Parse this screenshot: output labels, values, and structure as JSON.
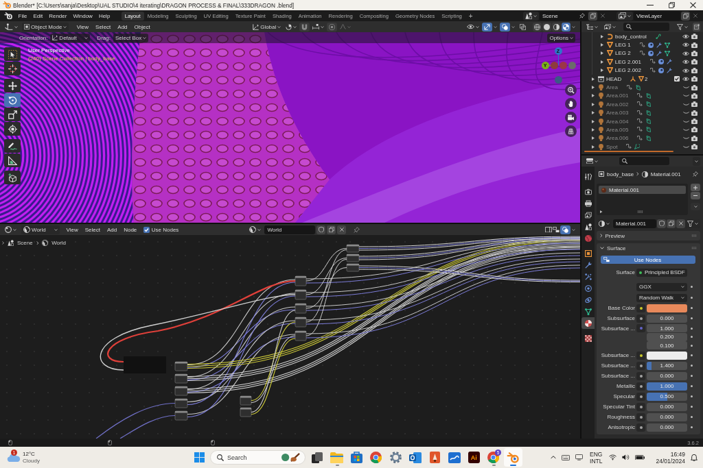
{
  "window": {
    "title": "Blender* [C:\\Users\\sanja\\Desktop\\UAL STUDIO\\4 iterating\\DRAGON PROCESS & FINAL\\333DRAGON .blend]"
  },
  "topbar": {
    "menus": [
      "File",
      "Edit",
      "Render",
      "Window",
      "Help"
    ],
    "workspaces": [
      {
        "label": "Layout",
        "selected": true
      },
      {
        "label": "Modeling",
        "selected": false
      },
      {
        "label": "Sculpting",
        "selected": false
      },
      {
        "label": "UV Editing",
        "selected": false
      },
      {
        "label": "Texture Paint",
        "selected": false
      },
      {
        "label": "Shading",
        "selected": false
      },
      {
        "label": "Animation",
        "selected": false
      },
      {
        "label": "Rendering",
        "selected": false
      },
      {
        "label": "Compositing",
        "selected": false
      },
      {
        "label": "Geometry Nodes",
        "selected": false
      },
      {
        "label": "Scripting",
        "selected": false
      }
    ],
    "add_workspace": "+",
    "scene": "Scene",
    "view_layer": "ViewLayer"
  },
  "viewport": {
    "mode": "Object Mode",
    "menus": [
      "View",
      "Select",
      "Add",
      "Object"
    ],
    "transform_orientation": "Global",
    "toggles": [
      {
        "kind": "snap",
        "on": false
      },
      {
        "kind": "proportional_editing",
        "on": false
      },
      {
        "kind": "gizmos",
        "on": true
      },
      {
        "kind": "overlays",
        "on": true
      },
      {
        "kind": "xray",
        "on": false
      }
    ],
    "shading_modes": [
      {
        "kind": "wireframe",
        "selected": false
      },
      {
        "kind": "solid",
        "selected": false
      },
      {
        "kind": "material_preview",
        "selected": false
      },
      {
        "kind": "rendered",
        "selected": true
      }
    ],
    "tool_settings": {
      "orientation_label": "Orientation:",
      "orientation": "Default",
      "drag_label": "Drag:",
      "drag": "Select Box",
      "options": "Options"
    },
    "view_name": "User Perspective",
    "view_info": "(240) Scene Collection | body_base",
    "tool_groups": [
      [
        {
          "kind": "select_box",
          "selected": false
        },
        {
          "kind": "cursor",
          "selected": false
        }
      ],
      [
        {
          "kind": "move",
          "selected": false
        },
        {
          "kind": "rotate",
          "selected": true
        },
        {
          "kind": "scale",
          "selected": false
        },
        {
          "kind": "transform",
          "selected": false
        }
      ],
      [
        {
          "kind": "annotate",
          "selected": false
        },
        {
          "kind": "measure",
          "selected": false
        }
      ],
      [
        {
          "kind": "add_cube",
          "selected": false
        }
      ]
    ],
    "gizmo_axes": [
      {
        "label": "Z",
        "color": "#2f74c9"
      },
      {
        "label": "Y",
        "color": "#7cb318"
      },
      {
        "color": "#8e3b3b"
      },
      {
        "color": "#9c3548"
      },
      {
        "color": "#6b6b6b"
      },
      {
        "color": "#3b5a86"
      }
    ]
  },
  "outliner": {
    "scrolled_parent": {
      "children": [
        {
          "name": "body_control",
          "kind": "armature",
          "extras": [
            {
              "kind": "bone_constraint"
            }
          ],
          "visible": true
        },
        {
          "name": "LEG 1",
          "kind": "mesh",
          "extras": [
            {
              "kind": "parent"
            },
            {
              "kind": "modifier"
            },
            {
              "kind": "wrench"
            },
            {
              "kind": "vertex_data"
            }
          ],
          "visible": true
        },
        {
          "name": "LEG 2",
          "kind": "mesh",
          "extras": [
            {
              "kind": "parent"
            },
            {
              "kind": "modifier"
            },
            {
              "kind": "wrench"
            },
            {
              "kind": "vertex_data"
            }
          ],
          "visible": true
        },
        {
          "name": "LEG 2.001",
          "kind": "mesh",
          "extras": [
            {
              "kind": "parent"
            },
            {
              "kind": "modifier"
            },
            {
              "kind": "wrench"
            }
          ],
          "visible": true
        },
        {
          "name": "LEG 2.002",
          "kind": "mesh",
          "extras": [
            {
              "kind": "parent"
            },
            {
              "kind": "modifier"
            },
            {
              "kind": "wrench"
            }
          ],
          "visible": true
        }
      ]
    },
    "items": [
      {
        "name": "HEAD",
        "kind": "collection",
        "extras": [
          {
            "kind": "armature"
          },
          {
            "kind": "mesh"
          }
        ],
        "count": "2",
        "checked": true,
        "visible": true
      },
      {
        "name": "Area",
        "kind": "light",
        "extras": [
          {
            "kind": "parent"
          },
          {
            "kind": "area_light"
          }
        ],
        "visible": false
      },
      {
        "name": "Area.001",
        "kind": "light",
        "extras": [
          {
            "kind": "parent"
          },
          {
            "kind": "area_light"
          }
        ],
        "visible": false
      },
      {
        "name": "Area.002",
        "kind": "light",
        "extras": [
          {
            "kind": "parent"
          },
          {
            "kind": "area_light"
          }
        ],
        "visible": false
      },
      {
        "name": "Area.003",
        "kind": "light",
        "extras": [
          {
            "kind": "parent"
          },
          {
            "kind": "area_light"
          }
        ],
        "visible": false
      },
      {
        "name": "Area.004",
        "kind": "light",
        "extras": [
          {
            "kind": "parent"
          },
          {
            "kind": "area_light"
          }
        ],
        "visible": false
      },
      {
        "name": "Area.005",
        "kind": "light",
        "extras": [
          {
            "kind": "parent"
          },
          {
            "kind": "area_light"
          }
        ],
        "visible": false
      },
      {
        "name": "Area.006",
        "kind": "light",
        "extras": [
          {
            "kind": "parent"
          },
          {
            "kind": "area_light"
          }
        ],
        "visible": false
      },
      {
        "name": "Spot",
        "kind": "light",
        "extras": [
          {
            "kind": "parent"
          },
          {
            "kind": "spot_light"
          }
        ],
        "visible": false
      }
    ]
  },
  "node_editor": {
    "shader_type": "World",
    "menus": [
      "View",
      "Select",
      "Add",
      "Node"
    ],
    "use_nodes": {
      "label": "Use Nodes",
      "checked": true
    },
    "datablock": "World",
    "overlays_on": true,
    "breadcrumbs": [
      "Scene",
      "World"
    ]
  },
  "properties": {
    "tab_groups": [
      [
        {
          "kind": "tool",
          "selected": false
        }
      ],
      [
        {
          "kind": "render",
          "selected": false
        },
        {
          "kind": "output",
          "selected": false
        },
        {
          "kind": "view_layer",
          "selected": false
        },
        {
          "kind": "scene",
          "selected": false
        },
        {
          "kind": "world",
          "selected": false
        }
      ],
      [
        {
          "kind": "object",
          "selected": false
        },
        {
          "kind": "modifiers",
          "selected": false
        },
        {
          "kind": "particles",
          "selected": false
        },
        {
          "kind": "physics",
          "selected": false
        },
        {
          "kind": "constraints",
          "selected": false
        },
        {
          "kind": "data",
          "selected": false
        },
        {
          "kind": "material",
          "selected": true
        }
      ],
      [
        {
          "kind": "texture",
          "selected": false
        }
      ]
    ],
    "object": "body_base",
    "material": "Material.001",
    "slots": [
      {
        "name": "Material.001",
        "selected": true
      }
    ],
    "datablock": "Material.001",
    "panels": [
      {
        "title": "Preview",
        "expanded": false
      },
      {
        "title": "Surface",
        "expanded": true,
        "use_nodes": "Use Nodes",
        "surface_label": "Surface",
        "surface": "Principled BSDF",
        "distribution": "GGX",
        "subsurface_method": "Random Walk",
        "inputs": [
          {
            "label": "Base Color",
            "kind": "color",
            "color": "#e8895b"
          },
          {
            "label": "Subsurface",
            "kind": "float",
            "value": "0.000"
          },
          {
            "label": "Subsurface ...",
            "kind": "vector",
            "values": [
              "1.000",
              "0.200",
              "0.100"
            ]
          },
          {
            "label": "Subsurface ...",
            "kind": "color",
            "color": "#ececec"
          },
          {
            "label": "Subsurface ...",
            "kind": "float",
            "value": "1.400",
            "level": 0.12
          },
          {
            "label": "Subsurface ...",
            "kind": "float",
            "value": "0.000"
          },
          {
            "label": "Metallic",
            "kind": "float",
            "value": "1.000",
            "level": 1
          },
          {
            "label": "Specular",
            "kind": "float",
            "value": "0.500",
            "level": 0.5
          },
          {
            "label": "Specular Tint",
            "kind": "float",
            "value": "0.000"
          },
          {
            "label": "Roughness",
            "kind": "float",
            "value": "0.000"
          },
          {
            "label": "Anisotropic",
            "kind": "float",
            "value": "0.000"
          }
        ]
      }
    ]
  },
  "status_bar": {
    "version": "3.6.2"
  },
  "taskbar": {
    "weather": {
      "badge": "1",
      "temperature": "12°C",
      "condition": "Cloudy"
    },
    "search": {
      "placeholder": "Search"
    },
    "apps": [
      {
        "kind": "task_view",
        "running": false,
        "selected": false
      },
      {
        "kind": "file_explorer",
        "running": true,
        "selected": false
      },
      {
        "kind": "store",
        "running": false,
        "selected": false
      },
      {
        "kind": "chrome",
        "running": false,
        "selected": false
      },
      {
        "kind": "settings",
        "running": false,
        "selected": false
      },
      {
        "kind": "outlook",
        "running": false,
        "selected": false
      },
      {
        "kind": "paint",
        "running": false,
        "selected": false
      },
      {
        "kind": "whiteboard",
        "running": false,
        "selected": false
      },
      {
        "kind": "illustrator",
        "label": "Ai",
        "running": false,
        "selected": false
      },
      {
        "kind": "chrome",
        "badge": "5",
        "running": true,
        "selected": false
      },
      {
        "kind": "blender",
        "running": true,
        "selected": true
      }
    ],
    "language": "ENG",
    "keyboard_layout": "INTL",
    "time": "16:49",
    "date": "24/01/2024"
  }
}
